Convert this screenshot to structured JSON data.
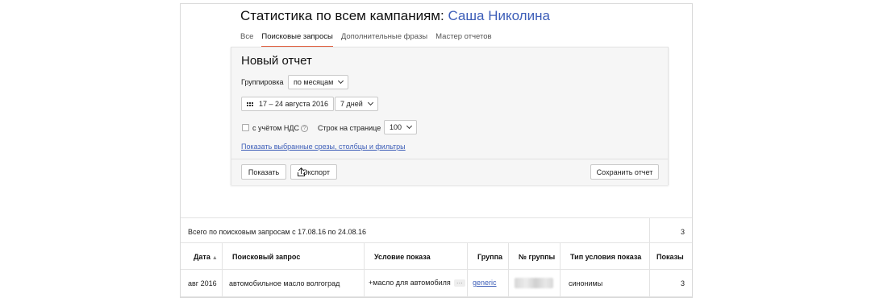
{
  "header": {
    "title_prefix": "Статистика по всем кампаниям:",
    "user_name": "Саша Николина"
  },
  "tabs": [
    {
      "label": "Все",
      "active": false
    },
    {
      "label": "Поисковые запросы",
      "active": true
    },
    {
      "label": "Дополнительные фразы",
      "active": false
    },
    {
      "label": "Мастер отчетов",
      "active": false
    }
  ],
  "report": {
    "title": "Новый отчет",
    "grouping_label": "Группировка",
    "grouping_value": "по месяцам",
    "date_range": "17 – 24 августа 2016",
    "period_value": "7 дней",
    "vat_label": "с учётом НДС",
    "vat_help": "?",
    "rows_label": "Строк на странице",
    "rows_value": "100",
    "filters_link": "Показать выбранные срезы, столбцы и фильтры",
    "show_button": "Показать",
    "export_button": "Экспорт",
    "save_button": "Сохранить отчет"
  },
  "table": {
    "summary_label": "Всего по поисковым запросам с 17.08.16 по 24.08.16",
    "summary_total": "3",
    "sort_indicator": "▲",
    "columns": [
      "Дата",
      "Поисковый запрос",
      "Условие показа",
      "Группа",
      "№ группы",
      "Тип условия показа",
      "Показы"
    ],
    "rows": [
      {
        "date": "авг 2016",
        "query": "автомобильное масло волгоград",
        "condition": "+масло для автомобиля",
        "condition_more": "···",
        "group": "generic",
        "group_number": "",
        "condition_type": "синонимы",
        "impressions": "3"
      }
    ]
  },
  "colors": {
    "accent_link": "#3d5eb8",
    "active_tab_underline": "#e35b3a",
    "panel_background": "#f6f6f6"
  }
}
